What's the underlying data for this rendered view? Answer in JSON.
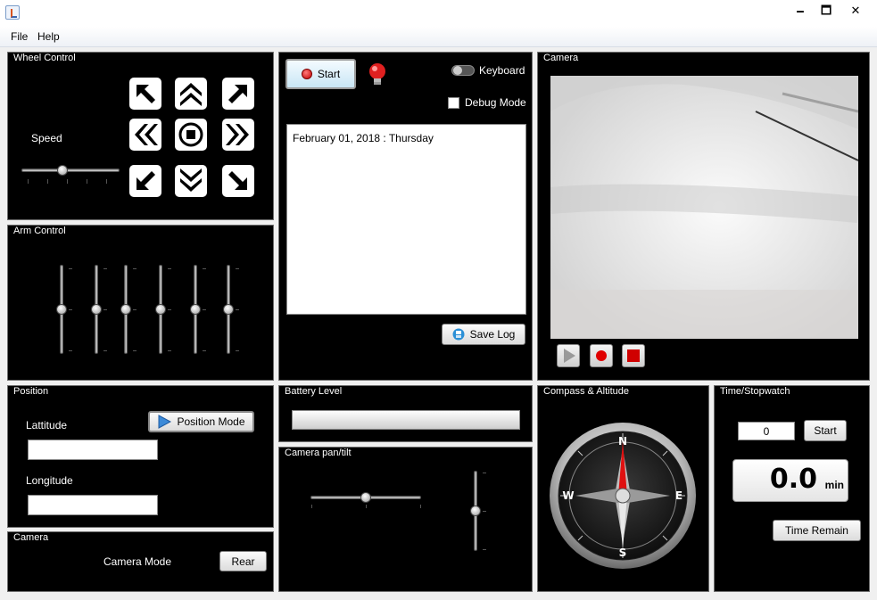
{
  "window": {
    "minimize": "🗕",
    "maximize": "🗖",
    "close": "✕"
  },
  "menu": {
    "items": [
      "File",
      "Help"
    ]
  },
  "wheel_control": {
    "title": "Wheel Control",
    "speed_label": "Speed",
    "speed_value": 0.42,
    "buttons": [
      "up-left",
      "up",
      "up-right",
      "left",
      "stop",
      "right",
      "down-left",
      "down",
      "down-right"
    ]
  },
  "arm_control": {
    "title": "Arm Control",
    "joint_values": [
      0.5,
      0.5,
      0.5,
      0.5,
      0.5,
      0.5
    ]
  },
  "log_panel": {
    "start_label": "Start",
    "keyboard_label": "Keyboard",
    "keyboard_on": false,
    "debug_label": "Debug Mode",
    "debug_checked": false,
    "log_text": "February 01, 2018 : Thursday",
    "save_label": "Save Log",
    "status_light": "off"
  },
  "camera_view": {
    "title": "Camera",
    "controls": [
      "play",
      "record",
      "stop"
    ]
  },
  "position": {
    "title": "Position",
    "mode_label": "Position Mode",
    "lat_label": "Lattitude",
    "lat_value": "",
    "lon_label": "Longitude",
    "lon_value": ""
  },
  "battery": {
    "title": "Battery Level",
    "level": 0.0
  },
  "pan_tilt": {
    "title": "Camera pan/tilt",
    "pan": 0.5,
    "tilt": 0.5
  },
  "compass": {
    "title": "Compass & Altitude",
    "heading_deg": 0,
    "labels": {
      "n": "N",
      "s": "S",
      "e": "E",
      "w": "W"
    }
  },
  "stopwatch": {
    "title": "Time/Stopwatch",
    "input_value": "0",
    "start_label": "Start",
    "display_value": "0.0",
    "display_unit": "min",
    "remain_label": "Time Remain"
  },
  "camera_mode": {
    "title": "Camera",
    "label": "Camera Mode",
    "button_label": "Rear"
  }
}
